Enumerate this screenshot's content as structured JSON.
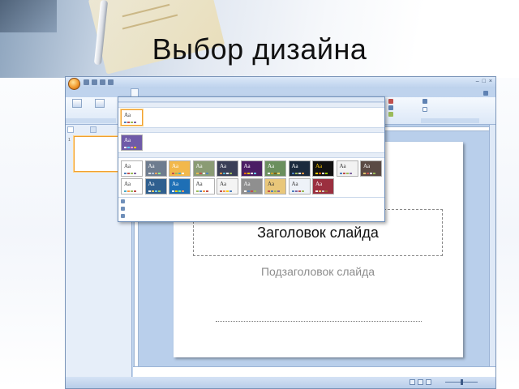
{
  "slide": {
    "title": "Выбор дизайна"
  },
  "app": {
    "window_title": "",
    "tabs": [
      {
        "label": "",
        "active": false
      },
      {
        "label": "",
        "active": false
      },
      {
        "label": "",
        "active": true
      },
      {
        "label": "",
        "active": false
      },
      {
        "label": "",
        "active": false
      },
      {
        "label": "",
        "active": false
      },
      {
        "label": "",
        "active": false
      }
    ],
    "ribbon": {
      "group_page_setup": "",
      "btn_page_setup": "",
      "btn_orientation": "",
      "colors": "",
      "fonts": "",
      "effects": "",
      "bg_styles": "",
      "hide_bg": "",
      "bg_group": ""
    },
    "left_pane": {
      "tab_slides": "",
      "tab_outline": "",
      "close": "×",
      "thumb_num": "1"
    },
    "canvas": {
      "title_placeholder": "Заголовок слайда",
      "subtitle_placeholder": "Подзаголовок слайда"
    },
    "notes_placeholder": "",
    "status": {
      "slide_info": "",
      "theme_name": "",
      "language": "",
      "zoom": ""
    }
  },
  "themes_panel": {
    "header": "",
    "section_this_presentation": "",
    "section_custom": "",
    "section_builtin": "",
    "aa": "Aa",
    "links": [
      {
        "label": "",
        "icon": "online-icon"
      },
      {
        "label": "",
        "icon": "folder-icon"
      },
      {
        "label": "",
        "icon": "save-icon"
      }
    ],
    "themes": [
      {
        "bg": "#ffffff",
        "fg": "#333333",
        "dots": [
          "#4f81bd",
          "#c0504d",
          "#9bbb59",
          "#8064a2"
        ]
      },
      {
        "bg": "#6e7c8f",
        "fg": "#ffffff",
        "dots": [
          "#e0e0e0",
          "#b0c4de",
          "#f4a460",
          "#90ee90"
        ]
      },
      {
        "bg": "#f2b84b",
        "fg": "#ffffff",
        "dots": [
          "#c0504d",
          "#9bbb59",
          "#4bacc6",
          "#ffffff"
        ]
      },
      {
        "bg": "#8a9b74",
        "fg": "#ffffff",
        "dots": [
          "#e6b94d",
          "#c0504d",
          "#ffffff",
          "#4f81bd"
        ]
      },
      {
        "bg": "#3a3f57",
        "fg": "#ffffff",
        "dots": [
          "#f79646",
          "#4bacc6",
          "#ffffff",
          "#9bbb59"
        ]
      },
      {
        "bg": "#4b1e64",
        "fg": "#ffffff",
        "dots": [
          "#e46c0a",
          "#ffcc00",
          "#ffffff",
          "#66ccff"
        ]
      },
      {
        "bg": "#6b8f5e",
        "fg": "#ffffff",
        "dots": [
          "#ffffff",
          "#c9a227",
          "#7f6000",
          "#ffd966"
        ]
      },
      {
        "bg": "#1b2a3d",
        "fg": "#ffffff",
        "dots": [
          "#4f81bd",
          "#9bbb59",
          "#ffffff",
          "#f79646"
        ]
      },
      {
        "bg": "#111111",
        "fg": "#ffcc00",
        "dots": [
          "#ffcc00",
          "#ff6600",
          "#ffffff",
          "#99cc00"
        ]
      },
      {
        "bg": "#f2f2f2",
        "fg": "#333333",
        "dots": [
          "#4f81bd",
          "#c0504d",
          "#9bbb59",
          "#8064a2"
        ]
      },
      {
        "bg": "#5a4a44",
        "fg": "#ffffff",
        "dots": [
          "#e0c36a",
          "#c0504d",
          "#ffffff",
          "#9bbb59"
        ]
      },
      {
        "bg": "#ffffff",
        "fg": "#333333",
        "dots": [
          "#4bacc6",
          "#f79646",
          "#9bbb59",
          "#c0504d"
        ]
      },
      {
        "bg": "#2f5f8f",
        "fg": "#ffffff",
        "dots": [
          "#ffffff",
          "#ffcc66",
          "#66ccff",
          "#99cc66"
        ]
      },
      {
        "bg": "#1e6fb5",
        "fg": "#ffffff",
        "dots": [
          "#ffffff",
          "#ffcc00",
          "#66ff99",
          "#ff9966"
        ]
      },
      {
        "bg": "#ffffff",
        "fg": "#333333",
        "dots": [
          "#9bbb59",
          "#4f81bd",
          "#f79646",
          "#c0504d"
        ]
      },
      {
        "bg": "#f4f4f4",
        "fg": "#333333",
        "dots": [
          "#c0504d",
          "#f79646",
          "#ffcc00",
          "#4f81bd"
        ]
      },
      {
        "bg": "#8f8f8f",
        "fg": "#ffffff",
        "dots": [
          "#ffffff",
          "#4f81bd",
          "#c0504d",
          "#9bbb59"
        ]
      },
      {
        "bg": "#e9c77a",
        "fg": "#333333",
        "dots": [
          "#c0504d",
          "#4f81bd",
          "#9bbb59",
          "#8064a2"
        ]
      },
      {
        "bg": "#eef2f8",
        "fg": "#333333",
        "dots": [
          "#4f81bd",
          "#8064a2",
          "#c0504d",
          "#9bbb59"
        ]
      },
      {
        "bg": "#9b2f3f",
        "fg": "#ffffff",
        "dots": [
          "#ffffff",
          "#ffcc66",
          "#cccccc",
          "#996633"
        ]
      }
    ]
  }
}
